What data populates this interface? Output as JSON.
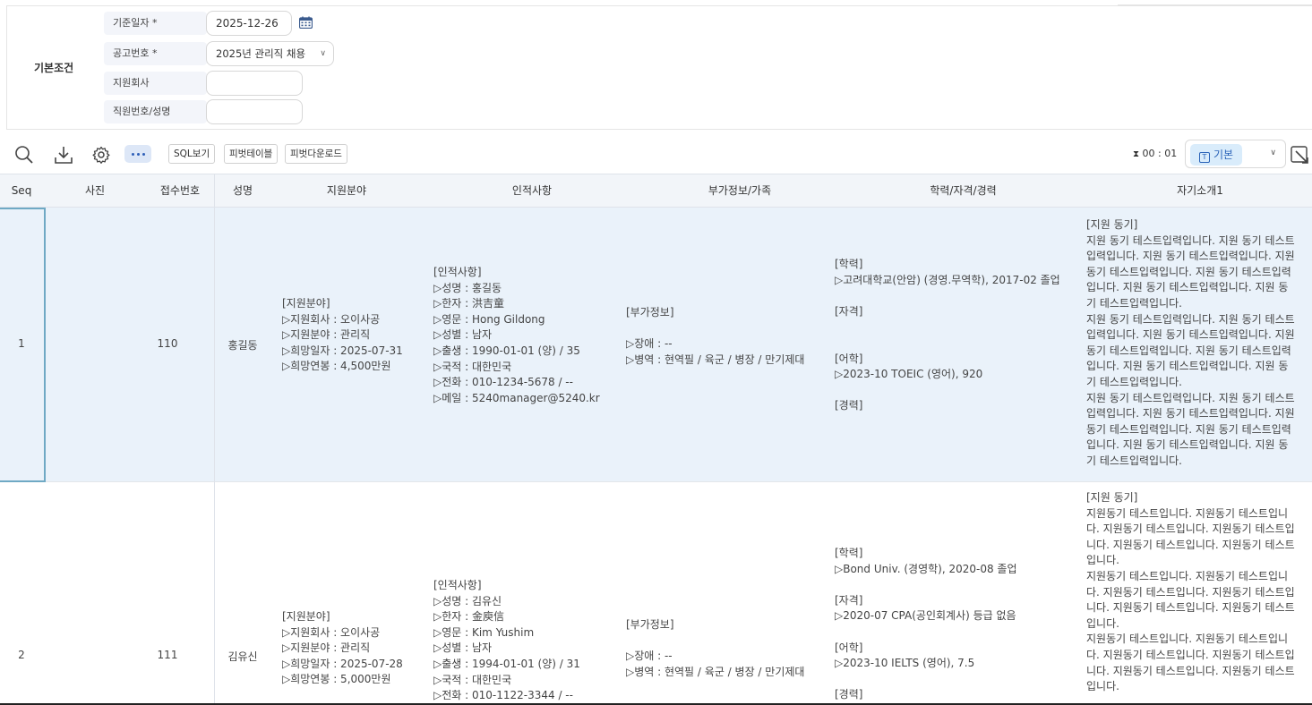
{
  "conditions": {
    "group_label": "기본조건",
    "fields": [
      {
        "label": "기준일자 *",
        "value": "2025-12-26"
      },
      {
        "label": "공고번호 *",
        "value": "2025년 관리직 채용"
      },
      {
        "label": "지원회사",
        "value": ""
      },
      {
        "label": "직원번호/성명",
        "value": ""
      }
    ]
  },
  "toolbar": {
    "buttons": [
      "SQL보기",
      "피벗테이블",
      "피벗다운로드"
    ],
    "timer": "00 : 01",
    "view_select": "기본",
    "view_icon_letter": "T",
    "icons": [
      "search-icon",
      "download-icon",
      "gear-icon",
      "more-icon",
      "hourglass-icon",
      "select-area-icon"
    ]
  },
  "grid": {
    "columns": [
      "Seq",
      "사진",
      "접수번호",
      "성명",
      "지원분야",
      "인적사항",
      "부가정보/가족",
      "학력/자격/경력",
      "자기소개1"
    ],
    "rows": [
      {
        "seq": "1",
        "receipt_no": "110",
        "name": "홍길동",
        "field": "[지원분야]\n▷지원회사 : 오이사공\n▷지원분야 : 관리직\n▷희망일자 : 2025-07-31\n▷희망연봉 : 4,500만원",
        "personal": "[인적사항]\n▷성명 : 홍길동\n▷한자 : 洪吉童\n▷영문 : Hong Gildong\n▷성별 : 남자\n▷출생 : 1990-01-01 (양) / 35\n▷국적 : 대한민국\n▷전화 : 010-1234-5678 / --\n▷메일 : 5240manager@5240.kr",
        "extra": "[부가정보]\n\n▷장애 : --\n▷병역 : 현역필 / 육군 / 병장 / 만기제대",
        "education": "[학력]\n▷고려대학교(안암) (경영.무역학), 2017-02 졸업\n\n[자격]\n\n\n[어학]\n▷2023-10 TOEIC (영어), 920\n\n[경력]",
        "intro": "[지원 동기]\n지원 동기 테스트입력입니다. 지원 동기 테스트입력입니다. 지원 동기 테스트입력입니다. 지원 동기 테스트입력입니다. 지원 동기 테스트입력입니다. 지원 동기 테스트입력입니다. 지원 동기 테스트입력입니다.\n지원 동기 테스트입력입니다. 지원 동기 테스트입력입니다. 지원 동기 테스트입력입니다. 지원 동기 테스트입력입니다. 지원 동기 테스트입력입니다. 지원 동기 테스트입력입니다. 지원 동기 테스트입력입니다.\n지원 동기 테스트입력입니다. 지원 동기 테스트입력입니다. 지원 동기 테스트입력입니다. 지원 동기 테스트입력입니다. 지원 동기 테스트입력입니다. 지원 동기 테스트입력입니다. 지원 동기 테스트입력입니다."
      },
      {
        "seq": "2",
        "receipt_no": "111",
        "name": "김유신",
        "field": "[지원분야]\n▷지원회사 : 오이사공\n▷지원분야 : 관리직\n▷희망일자 : 2025-07-28\n▷희망연봉 : 5,000만원",
        "personal": "[인적사항]\n▷성명 : 김유신\n▷한자 : 金庾信\n▷영문 : Kim Yushim\n▷성별 : 남자\n▷출생 : 1994-01-01 (양) / 31\n▷국적 : 대한민국\n▷전화 : 010-1122-3344 / --",
        "extra": "[부가정보]\n\n▷장애 : --\n▷병역 : 현역필 / 육군 / 병장 / 만기제대",
        "education": "[학력]\n▷Bond Univ. (경영학), 2020-08 졸업\n\n[자격]\n▷2020-07 CPA(공인회계사) 등급 없음\n\n[어학]\n▷2023-10 IELTS (영어), 7.5\n\n[경력]",
        "intro": "[지원 동기]\n지원동기 테스트입니다. 지원동기 테스트입니다. 지원동기 테스트입니다. 지원동기 테스트입니다. 지원동기 테스트입니다. 지원동기 테스트입니다.\n지원동기 테스트입니다. 지원동기 테스트입니다. 지원동기 테스트입니다. 지원동기 테스트입니다. 지원동기 테스트입니다. 지원동기 테스트입니다.\n지원동기 테스트입니다. 지원동기 테스트입니다. 지원동기 테스트입니다. 지원동기 테스트입니다. 지원동기 테스트입니다. 지원동기 테스트입니다."
      }
    ]
  }
}
